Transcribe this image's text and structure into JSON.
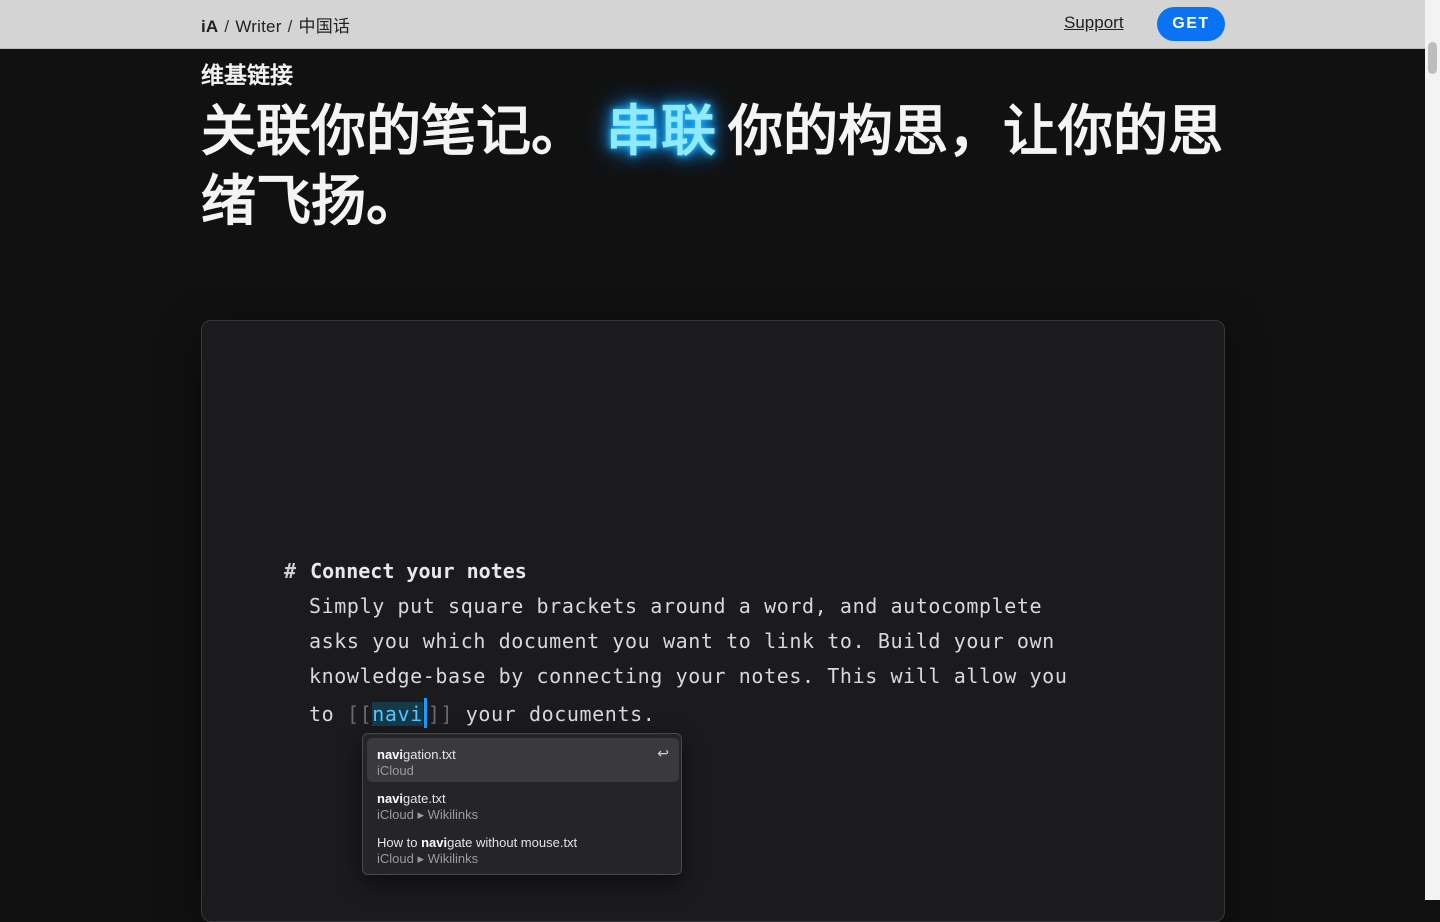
{
  "nav": {
    "brand": "iA",
    "separator": "/",
    "product": "Writer",
    "language": "中国话",
    "support": "Support",
    "get": "GET"
  },
  "hero": {
    "eyebrow": "维基链接",
    "headline_before": "关联你的笔记。",
    "headline_highlight": "串联",
    "headline_after": "你的构思，让你的思绪飞扬。"
  },
  "editor": {
    "heading_marker": "#",
    "heading": "Connect your notes",
    "lines": [
      "Simply put square brackets around a word, and autocomplete",
      "asks you which document you want to link to. Build your own",
      "knowledge-base by connecting your notes. This will allow you"
    ],
    "last_line_prefix": "to ",
    "open_brackets": "[[",
    "typed": "navi",
    "close_brackets": "]]",
    "last_line_suffix": " your documents."
  },
  "autocomplete": {
    "items": [
      {
        "match": "navi",
        "rest": "gation.txt",
        "prefix": "",
        "path": "iCloud",
        "selected": true,
        "enter_icon": "return-key-icon",
        "enter_glyph": "↩"
      },
      {
        "match": "navi",
        "rest": "gate.txt",
        "prefix": "",
        "path": "iCloud ▸ Wikilinks",
        "selected": false
      },
      {
        "match": "navi",
        "rest": "gate without mouse.txt",
        "prefix": "How to ",
        "path": "iCloud ▸ Wikilinks",
        "selected": false
      }
    ]
  },
  "colors": {
    "topbar": "#d4d4d4",
    "accent": "#0a73f4",
    "highlight_glow": "#27bfff",
    "background": "#111111",
    "editor_bg": "#1b1a1d",
    "link_text": "#55c7ff"
  }
}
